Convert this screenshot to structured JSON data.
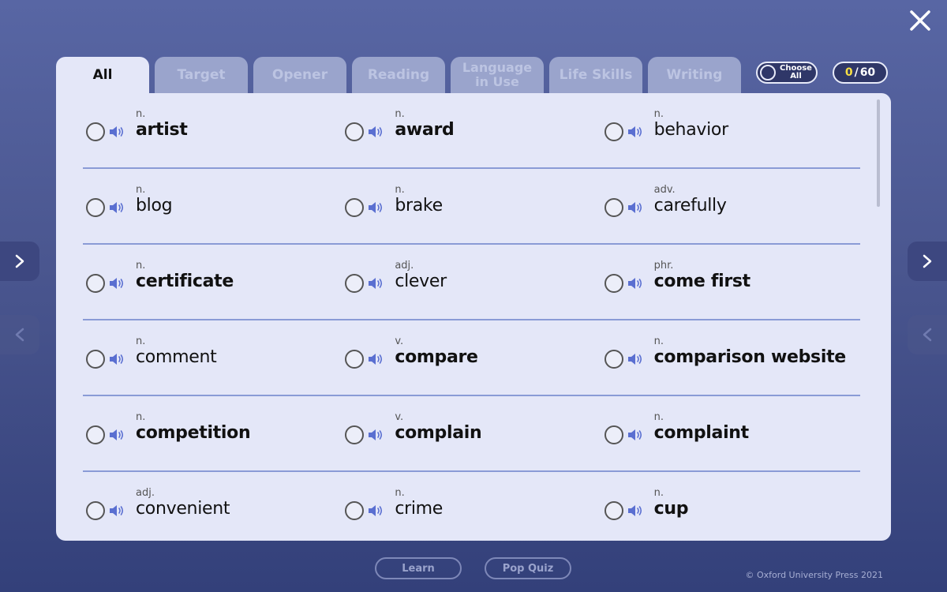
{
  "tabs": [
    {
      "label": "All",
      "active": true
    },
    {
      "label": "Target",
      "active": false
    },
    {
      "label": "Opener",
      "active": false
    },
    {
      "label": "Reading",
      "active": false
    },
    {
      "label": "Language\nin Use",
      "active": false
    },
    {
      "label": "Life Skills",
      "active": false
    },
    {
      "label": "Writing",
      "active": false
    }
  ],
  "choose_all": {
    "label_line1": "Choose",
    "label_line2": "All"
  },
  "counter": {
    "selected": "0",
    "separator": "/",
    "total": "60"
  },
  "words": [
    [
      {
        "pos": "n.",
        "word": "artist",
        "bold": true
      },
      {
        "pos": "n.",
        "word": "award",
        "bold": true
      },
      {
        "pos": "n.",
        "word": "behavior",
        "bold": false
      }
    ],
    [
      {
        "pos": "n.",
        "word": "blog",
        "bold": false
      },
      {
        "pos": "n.",
        "word": "brake",
        "bold": false
      },
      {
        "pos": "adv.",
        "word": "carefully",
        "bold": false
      }
    ],
    [
      {
        "pos": "n.",
        "word": "certificate",
        "bold": true
      },
      {
        "pos": "adj.",
        "word": "clever",
        "bold": false
      },
      {
        "pos": "phr.",
        "word": "come first",
        "bold": true
      }
    ],
    [
      {
        "pos": "n.",
        "word": "comment",
        "bold": false
      },
      {
        "pos": "v.",
        "word": "compare",
        "bold": true
      },
      {
        "pos": "n.",
        "word": "comparison website",
        "bold": true
      }
    ],
    [
      {
        "pos": "n.",
        "word": "competition",
        "bold": true
      },
      {
        "pos": "v.",
        "word": "complain",
        "bold": true
      },
      {
        "pos": "n.",
        "word": "complaint",
        "bold": true
      }
    ],
    [
      {
        "pos": "adj.",
        "word": "convenient",
        "bold": false
      },
      {
        "pos": "n.",
        "word": "crime",
        "bold": false
      },
      {
        "pos": "n.",
        "word": "cup",
        "bold": true
      }
    ]
  ],
  "footer": {
    "learn_label": "Learn",
    "quiz_label": "Pop Quiz",
    "copyright": "© Oxford University Press 2021"
  },
  "icons": {
    "close": "close-icon",
    "radio": "radio-circle-icon",
    "speaker": "speaker-icon",
    "next": "chevron-right-icon",
    "prev": "chevron-left-icon"
  },
  "colors": {
    "accent_speaker": "#5a6fd1",
    "counter_selected": "#f7df44",
    "divider": "#8a9bd6"
  }
}
